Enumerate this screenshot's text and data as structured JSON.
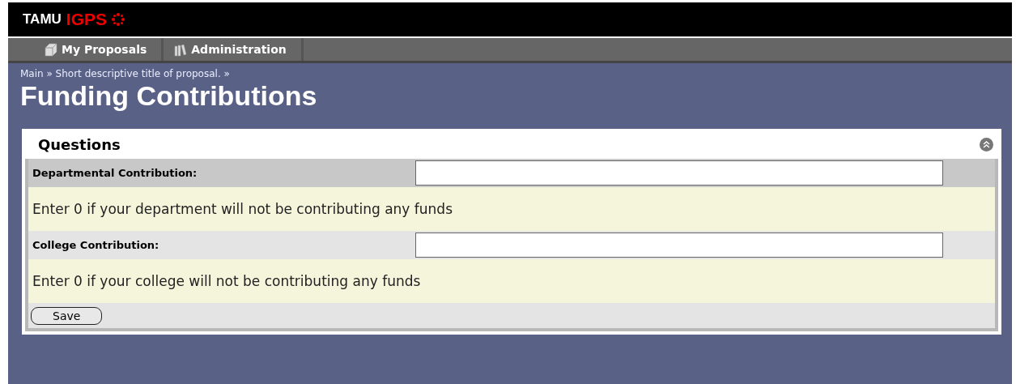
{
  "header": {
    "logo_left": "TAMU",
    "logo_right": "IGPS"
  },
  "tabs": [
    {
      "label": "My Proposals"
    },
    {
      "label": "Administration"
    }
  ],
  "breadcrumb": "Main » Short descriptive title of proposal. »",
  "title": "Funding Contributions",
  "panel": {
    "title": "Questions",
    "expanded": true,
    "questions": [
      {
        "label": "Departmental Contribution:",
        "help": "Enter 0 if your department will not be contributing any funds"
      },
      {
        "label": "College Contribution:",
        "help": "Enter 0 if your college will not be contributing any funds"
      }
    ],
    "button": "Save"
  }
}
